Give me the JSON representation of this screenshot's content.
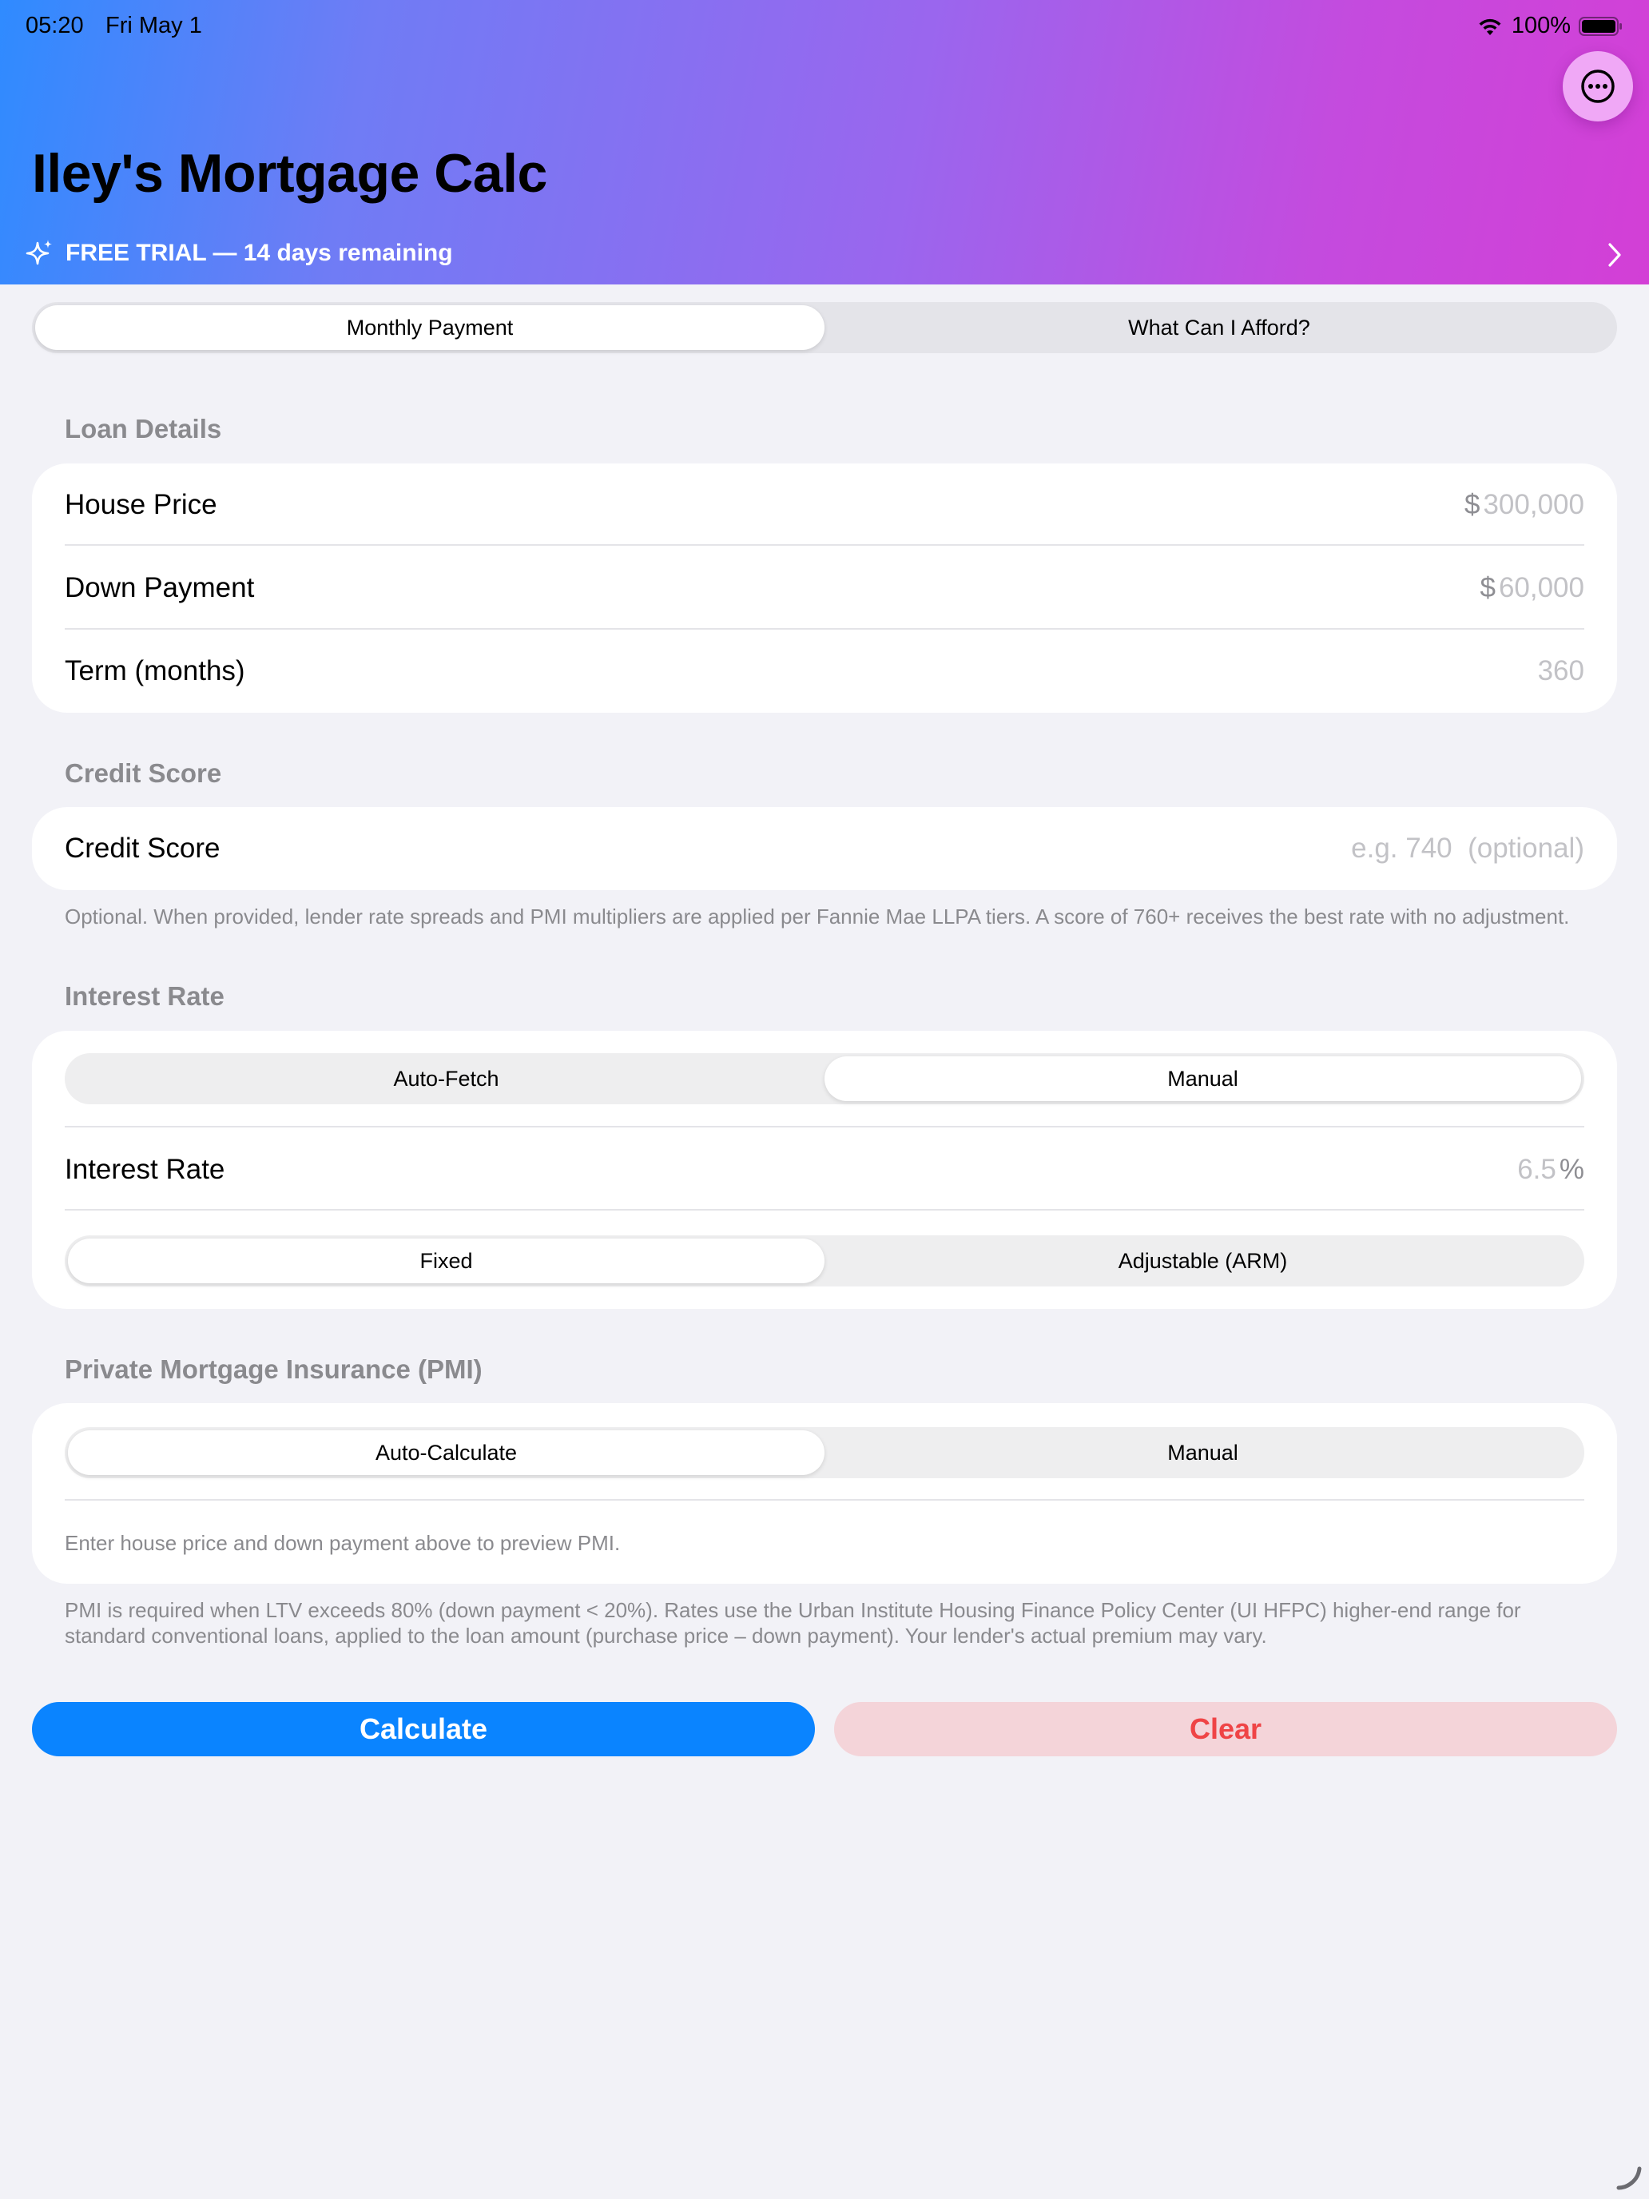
{
  "status_bar": {
    "time": "05:20",
    "date": "Fri May 1",
    "battery": "100%"
  },
  "header": {
    "title": "Iley's Mortgage Calc",
    "trial_text": "FREE TRIAL — 14 days remaining",
    "gradient_start": "#2f8bff",
    "gradient_end": "#d33fd6"
  },
  "mode_tabs": {
    "monthly": "Monthly Payment",
    "afford": "What Can I Afford?",
    "selected": "monthly"
  },
  "loan_details": {
    "section_title": "Loan Details",
    "house_price": {
      "label": "House Price",
      "prefix": "$",
      "placeholder": "300,000"
    },
    "down_payment": {
      "label": "Down Payment",
      "prefix": "$",
      "placeholder": "60,000"
    },
    "term": {
      "label": "Term (months)",
      "placeholder": "360"
    }
  },
  "credit_score": {
    "section_title": "Credit Score",
    "label": "Credit Score",
    "placeholder": "e.g. 740  (optional)",
    "footnote": "Optional. When provided, lender rate spreads and PMI multipliers are applied per Fannie Mae LLPA tiers. A score of 760+ receives the best rate with no adjustment."
  },
  "interest_rate": {
    "section_title": "Interest Rate",
    "source_auto": "Auto-Fetch",
    "source_manual": "Manual",
    "source_selected": "manual",
    "label": "Interest Rate",
    "placeholder": "6.5",
    "suffix": "%",
    "type_fixed": "Fixed",
    "type_arm": "Adjustable (ARM)",
    "type_selected": "fixed"
  },
  "pmi": {
    "section_title": "Private Mortgage Insurance (PMI)",
    "auto": "Auto-Calculate",
    "manual": "Manual",
    "selected": "auto",
    "note": "Enter house price and down payment above to preview PMI.",
    "footnote": "PMI is required when LTV exceeds 80% (down payment < 20%). Rates use the Urban Institute Housing Finance Policy Center (UI HFPC) higher-end range for standard conventional loans, applied to the loan amount (purchase price – down payment). Your lender's actual premium may vary."
  },
  "actions": {
    "calculate": "Calculate",
    "clear": "Clear",
    "calculate_color": "#0a84ff",
    "clear_color": "#ef4446"
  },
  "icons": {
    "more": "ellipsis-circle-icon",
    "trial": "sparkle-icon",
    "chevron": "chevron-right-icon",
    "wifi": "wifi-icon",
    "battery": "battery-icon"
  }
}
